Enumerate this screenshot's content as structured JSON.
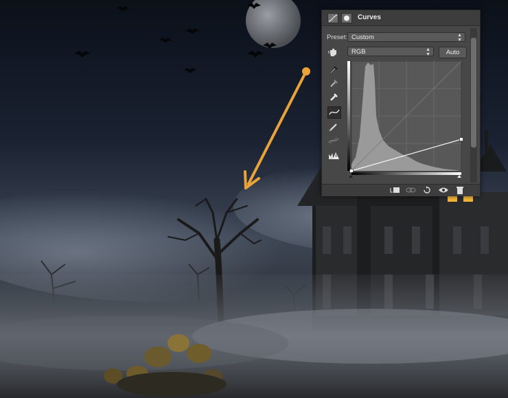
{
  "panel": {
    "title": "Curves",
    "preset_label": "Preset:",
    "preset_value": "Custom",
    "channel_value": "RGB",
    "auto_label": "Auto"
  },
  "icons": {
    "header": [
      "adjustment-curves-icon",
      "mask-icon"
    ],
    "tools": [
      "targeted-adjust-hand-icon",
      "black-point-eyedropper-icon",
      "gray-point-eyedropper-icon",
      "white-point-eyedropper-icon",
      "edit-points-curve-icon",
      "draw-pencil-icon",
      "smooth-curve-icon",
      "clipping-warning-icon"
    ],
    "footer": [
      "clip-to-layer-icon",
      "view-previous-state-icon",
      "reset-icon",
      "visibility-eye-icon",
      "trash-icon"
    ]
  },
  "colors": {
    "panel_bg": "#474747",
    "arrow": "#e8a33a",
    "window_glow": "#f3b43a"
  }
}
